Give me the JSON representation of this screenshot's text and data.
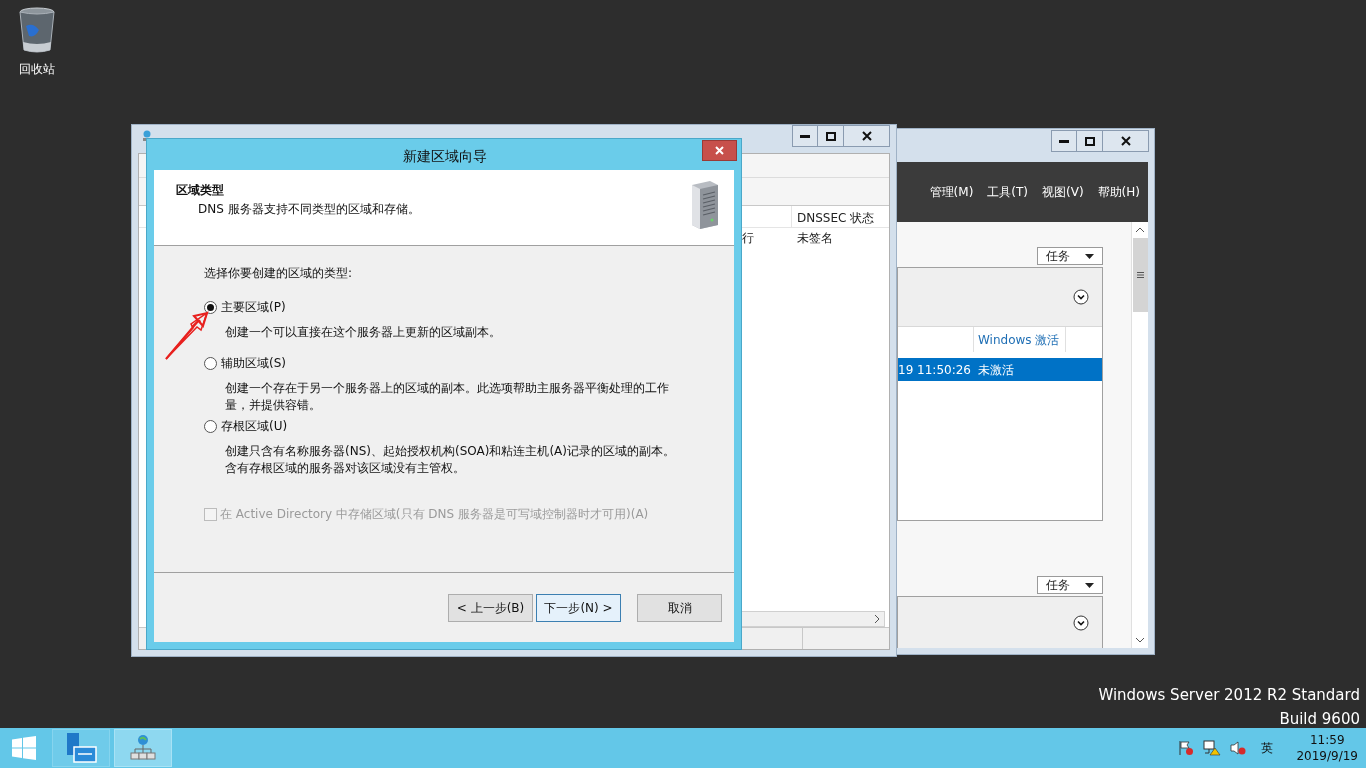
{
  "desktop": {
    "icons": [
      {
        "label": "回收站"
      }
    ],
    "os_edition": [
      "Windows Server 2012 R2 Standard",
      "Build 9600"
    ]
  },
  "server_manager": {
    "menu": [
      "管理(M)",
      "工具(T)",
      "视图(V)",
      "帮助(H)"
    ],
    "tasks_buttons": [
      "任务",
      "任务"
    ],
    "table": {
      "columns": [
        "",
        "Windows 激活"
      ],
      "rows": [
        {
          "cells": [
            "19 11:50:26",
            "未激活"
          ],
          "selected": true
        }
      ]
    }
  },
  "dns_manager": {
    "columns": [
      "",
      "DNSSEC 状态"
    ],
    "rows": [
      {
        "cells": [
          "行",
          "未签名"
        ]
      }
    ]
  },
  "wizard": {
    "title": "新建区域向导",
    "header_title": "区域类型",
    "header_subtitle": "DNS 服务器支持不同类型的区域和存储。",
    "prompt": "选择你要创建的区域的类型:",
    "options": [
      {
        "label": "主要区域(P)",
        "description": "创建一个可以直接在这个服务器上更新的区域副本。",
        "selected": true
      },
      {
        "label": "辅助区域(S)",
        "description": "创建一个存在于另一个服务器上的区域的副本。此选项帮助主服务器平衡处理的工作量，并提供容错。",
        "selected": false
      },
      {
        "label": "存根区域(U)",
        "description": "创建只含有名称服务器(NS)、起始授权机构(SOA)和粘连主机(A)记录的区域的副本。含有存根区域的服务器对该区域没有主管权。",
        "selected": false
      }
    ],
    "ad_option": {
      "label": "在 Active Directory 中存储区域(只有 DNS 服务器是可写域控制器时才可用)(A)",
      "checked": false,
      "disabled": true
    },
    "buttons": [
      {
        "label": "< 上一步(B)",
        "default": false
      },
      {
        "label": "下一步(N) >",
        "default": true
      },
      {
        "label": "取消",
        "default": false
      }
    ]
  },
  "taskbar": {
    "apps": [
      {
        "kind": "server-manager",
        "selected": false
      },
      {
        "kind": "dns",
        "selected": true
      }
    ],
    "tray": {
      "language": "英",
      "time": "11:59",
      "date": "2019/9/19"
    }
  }
}
